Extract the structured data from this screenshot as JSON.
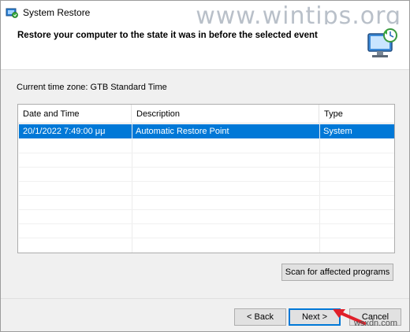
{
  "window": {
    "title": "System Restore",
    "watermark": "www.wintips.org"
  },
  "header": {
    "title": "Restore your computer to the state it was in before the selected event"
  },
  "timezone": "Current time zone: GTB Standard Time",
  "list": {
    "columns": [
      "Date and Time",
      "Description",
      "Type"
    ],
    "rows": [
      {
        "date": "20/1/2022 7:49:00 μμ",
        "description": "Automatic Restore Point",
        "type": "System",
        "selected": true
      }
    ]
  },
  "buttons": {
    "scan": "Scan for affected programs",
    "back": "< Back",
    "next": "Next >",
    "cancel": "Cancel"
  },
  "colors": {
    "selection": "#0078d7",
    "annotation_arrow": "#e0202a"
  },
  "sitemark": "wsxdn.com"
}
